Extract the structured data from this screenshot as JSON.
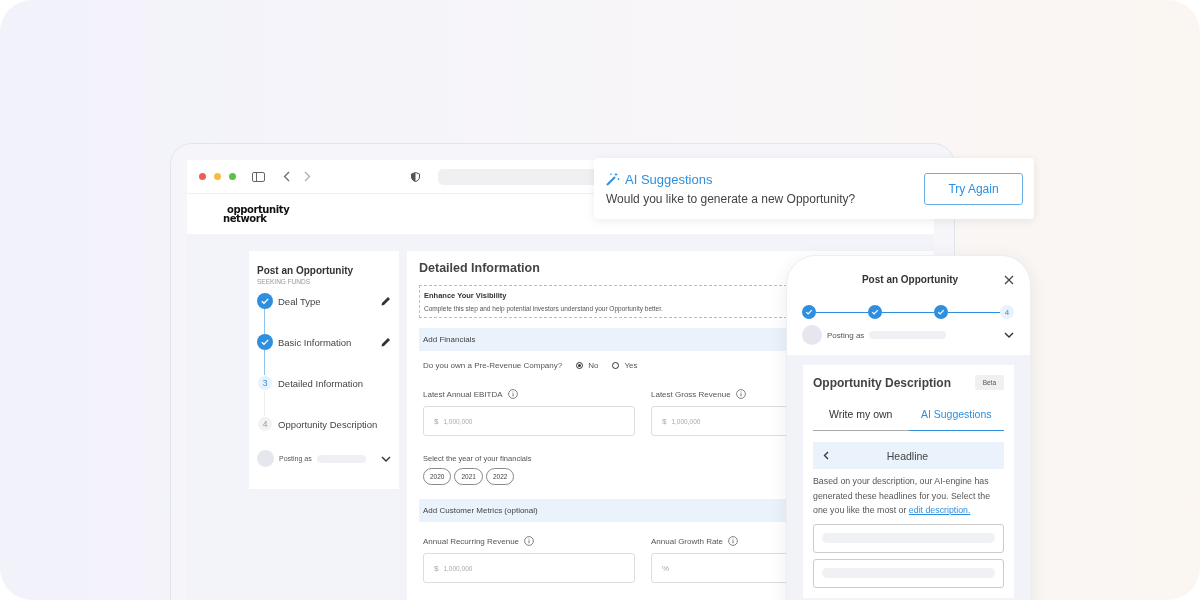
{
  "browser": {
    "logo": [
      "opportunity",
      "network"
    ]
  },
  "sidebar": {
    "title": "Post an Opportunity",
    "subtitle": "SEEKING FUNDS",
    "steps": [
      {
        "label": "Deal Type",
        "completed": true,
        "editable": true
      },
      {
        "label": "Basic Information",
        "completed": true,
        "editable": true
      },
      {
        "label": "Detailed Information",
        "completed": false,
        "current": true,
        "number": "3",
        "editable": false
      },
      {
        "label": "Opportunity Description",
        "completed": false,
        "current": false,
        "number": "4",
        "editable": false
      }
    ],
    "posting_as": "Posting as"
  },
  "main": {
    "title": "Detailed Information",
    "notice": {
      "title": "Enhance Your Visibility",
      "text": "Complete this step and help potential investors understand your Opportunity better."
    },
    "financials": {
      "heading": "Add Financials",
      "question": "Do you own a Pre-Revenue Company?",
      "options": [
        {
          "label": "No",
          "selected": true
        },
        {
          "label": "Yes",
          "selected": false
        }
      ],
      "fields": [
        {
          "label": "Latest Annual EBITDA",
          "prefix": "$",
          "placeholder": "1,000,000"
        },
        {
          "label": "Latest Gross Revenue",
          "prefix": "$",
          "placeholder": "1,000,000"
        }
      ],
      "years_label": "Select the year of your financials",
      "years": [
        {
          "label": "2020",
          "selected": false
        },
        {
          "label": "2021",
          "selected": false
        },
        {
          "label": "2022",
          "selected": false
        }
      ]
    },
    "metrics": {
      "heading": "Add Customer Metrics (optional)",
      "fields": [
        {
          "label": "Annual Recurring Revenue",
          "prefix": "$",
          "placeholder": "1,000,000"
        },
        {
          "label": "Annual Growth Rate",
          "prefix": "%"
        }
      ]
    }
  },
  "ai_card": {
    "title": "AI Suggestions",
    "text": "Would you like to generate a new Opportunity?",
    "button": "Try Again"
  },
  "phone": {
    "title": "Post an Opportunity",
    "progress": [
      {
        "completed": true
      },
      {
        "completed": true
      },
      {
        "completed": true
      },
      {
        "completed": false,
        "number": "4"
      }
    ],
    "posting_as": "Posting as",
    "card": {
      "title": "Opportunity Description",
      "badge": "Beta",
      "tabs": [
        {
          "label": "Write my own",
          "selected": false
        },
        {
          "label": "AI Suggestions",
          "selected": true
        }
      ],
      "header": "Headline",
      "text": "Based on your description, our AI-engine has generated these headlines for you. Select the one you like the most or ",
      "link": "edit description."
    }
  }
}
